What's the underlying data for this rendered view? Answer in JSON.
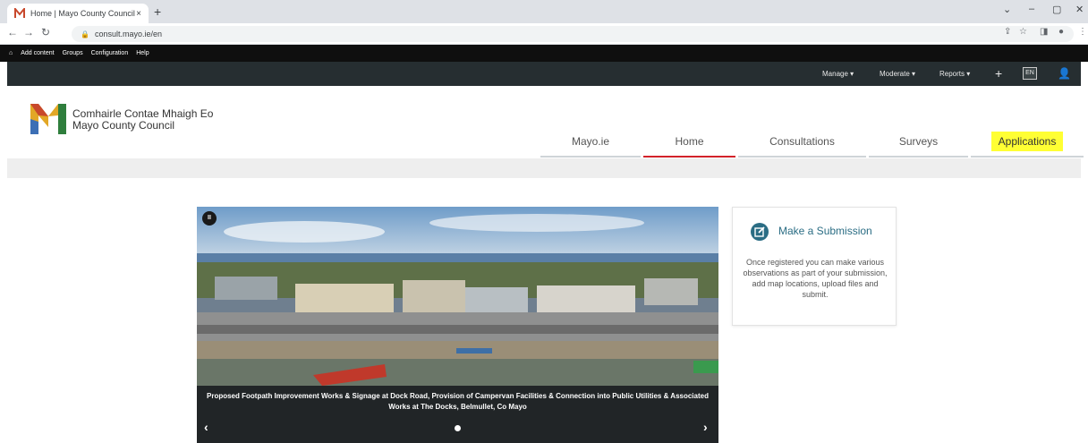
{
  "browser": {
    "tab_title": "Home | Mayo County Council",
    "tab_close": "×",
    "new_tab": "+",
    "url": "consult.mayo.ie/en",
    "win_min": "–",
    "win_max": "▢",
    "win_close": "✕",
    "win_dropdown": "⌄"
  },
  "admin_toolbar": {
    "items": [
      "Add content",
      "Groups",
      "Configuration",
      "Help"
    ]
  },
  "site_bar": {
    "manage": "Manage",
    "moderate": "Moderate",
    "reports": "Reports",
    "plus": "+",
    "language": "EN"
  },
  "header": {
    "org_name_irish": "Comhairle Contae Mhaigh Eo",
    "org_name_english": "Mayo County Council",
    "nav": [
      {
        "label": "Mayo.ie"
      },
      {
        "label": "Home"
      },
      {
        "label": "Consultations"
      },
      {
        "label": "Surveys"
      },
      {
        "label": "Applications"
      }
    ]
  },
  "slider": {
    "caption": "Proposed Footpath Improvement Works & Signage at Dock Road, Provision of Campervan Facilities & Connection into Public Utilities & Associated Works at The Docks, Belmullet, Co Mayo",
    "prev": "‹",
    "next": "›"
  },
  "card": {
    "title": "Make a Submission",
    "body": "Once registered you can make various observations as part of your submission, add map locations, upload files and submit."
  },
  "colors": {
    "accent": "#2b6d84",
    "active_nav": "#d2222a",
    "highlight": "#ffff33"
  }
}
